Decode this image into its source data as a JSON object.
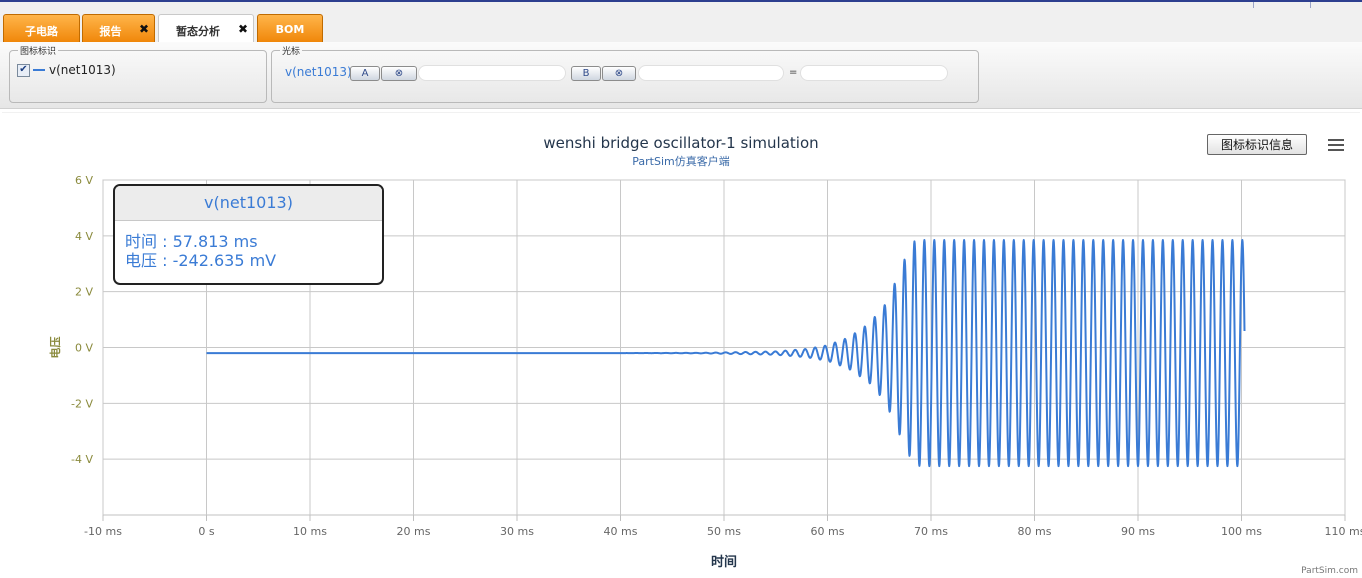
{
  "tabs": [
    {
      "label": "子电路",
      "closable": false,
      "active": false
    },
    {
      "label": "报告",
      "closable": true,
      "active": false
    },
    {
      "label": "暂态分析",
      "closable": true,
      "active": true
    },
    {
      "label": "BOM",
      "closable": false,
      "active": false
    }
  ],
  "legend_panel": {
    "title": "图标标识",
    "item_label": "v(net1013)",
    "checked": true
  },
  "cursor_panel": {
    "title": "光标",
    "signal": "v(net1013)",
    "button_a": "A",
    "button_b": "B",
    "equals": "=",
    "value_a": "",
    "value_b": "",
    "value_result": ""
  },
  "chart_header": {
    "title": "wenshi bridge oscillator-1 simulation",
    "subtitle": "PartSim仿真客户端",
    "info_button": "图标标识信息"
  },
  "credit": "PartSim.com",
  "tooltip": {
    "series": "v(net1013)",
    "time_label": "时间 : 57.813 ms",
    "voltage_label": "电压 : -242.635 mV"
  },
  "colors": {
    "accent": "#3a7bd5",
    "tab_orange": "#f39a1e",
    "axis_label": "#8a8a3c"
  },
  "chart_data": {
    "type": "line",
    "title": "wenshi bridge oscillator-1 simulation",
    "subtitle": "PartSim仿真客户端",
    "xlabel": "时间",
    "ylabel": "电压",
    "xlim": [
      -10,
      110
    ],
    "ylim": [
      -6,
      6
    ],
    "x_unit": "ms",
    "y_unit": "V",
    "x_ticks": [
      -10,
      0,
      10,
      20,
      30,
      40,
      50,
      60,
      70,
      80,
      90,
      100,
      110
    ],
    "x_tick_labels": [
      "-10 ms",
      "0 s",
      "10 ms",
      "20 ms",
      "30 ms",
      "40 ms",
      "50 ms",
      "60 ms",
      "70 ms",
      "80 ms",
      "90 ms",
      "100 ms",
      "110 ms"
    ],
    "y_ticks": [
      -4,
      -2,
      0,
      2,
      4,
      6
    ],
    "y_tick_labels": [
      "-4 V",
      "-2 V",
      "0 V",
      "2 V",
      "4 V",
      "6 V"
    ],
    "grid": true,
    "series": [
      {
        "name": "v(net1013)",
        "color": "#3a7bd5",
        "time_range": [
          0,
          100.3
        ],
        "dc_offset_v": -0.2,
        "oscillation_period_ms": 0.96,
        "steady_amplitude_v": 4.05,
        "envelope_points": [
          [
            0,
            0
          ],
          [
            40,
            0
          ],
          [
            48,
            0.01
          ],
          [
            55,
            0.06
          ],
          [
            58,
            0.15
          ],
          [
            60,
            0.28
          ],
          [
            62,
            0.55
          ],
          [
            64,
            1.05
          ],
          [
            65.5,
            1.7
          ],
          [
            66.5,
            2.5
          ],
          [
            67.5,
            3.4
          ],
          [
            68.4,
            4.0
          ],
          [
            69,
            4.05
          ],
          [
            100.3,
            4.05
          ]
        ]
      }
    ],
    "hover_point": {
      "x_ms": 57.813,
      "y_mv": -242.635
    }
  }
}
